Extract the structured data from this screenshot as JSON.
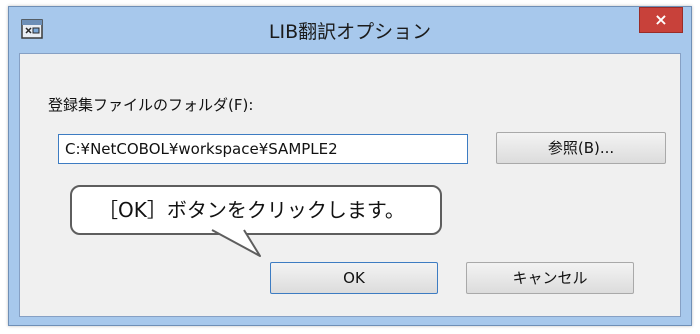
{
  "window": {
    "title": "LIB翻訳オプション",
    "close_label": "×"
  },
  "form": {
    "folder_label": "登録集ファイルのフォルダ(F):",
    "folder_value": "C:¥NetCOBOL¥workspace¥SAMPLE2",
    "browse_label": "参照(B)...",
    "ok_label": "OK",
    "cancel_label": "キャンセル"
  },
  "callout": {
    "text": "［OK］ボタンをクリックします。"
  },
  "icons": {
    "app": "app-window-icon",
    "close": "close-icon"
  }
}
